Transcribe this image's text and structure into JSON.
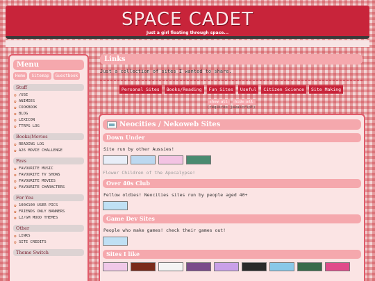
{
  "header": {
    "title": "SPACE CADET",
    "tagline": "Just a girl floating through space..."
  },
  "sidebar": {
    "menu_title": "Menu",
    "menu_buttons": [
      "Home",
      "Sitemap",
      "Guestbook"
    ],
    "sections": [
      {
        "title": "Stuff",
        "items": [
          "/USE",
          "ANIMIES",
          "COOKBOOK",
          "BLOG",
          "LEXICON",
          "TTRPG LOG"
        ]
      },
      {
        "title": "Books/Movies",
        "items": [
          "READING LOG",
          "A26 MOVIE CHALLENGE"
        ]
      },
      {
        "title": "Favs",
        "items": [
          "FAVOURITE MUSIC",
          "FAVOURITE TV SHOWS",
          "FAVOURITE MOVIES",
          "FAVOURITE CHARACTERS"
        ]
      },
      {
        "title": "For You",
        "items": [
          "100X100 USER PICS",
          "FRIENDS ONLY BANNERS",
          "L2/GM MOOD THEMES"
        ]
      },
      {
        "title": "Other",
        "items": [
          "LINKS",
          "SITE CREDITS"
        ]
      },
      {
        "title": "Theme Switch",
        "items": []
      }
    ]
  },
  "links": {
    "title": "Links",
    "intro": "Just a collection of sites I wanted to share.",
    "categories": [
      "Personal Sites",
      "Books/Reading",
      "Fun Sites",
      "Useful",
      "Citizen Science",
      "Site Making"
    ],
    "view_buttons": [
      "show all",
      "hide all"
    ],
    "js_note": "(requires javascript)"
  },
  "neocities": {
    "title": "Neocities / Nekoweb Sites",
    "sections": [
      {
        "title": "Down Under",
        "desc": "Site run by other Aussies!"
      },
      {
        "quote": "Flower Children of the Apocalypse!"
      },
      {
        "title": "Over 40s Club",
        "desc": "Fellow oldies! Neocities sites run by people aged 40+"
      },
      {
        "title": "Game Dev Sites",
        "desc": "People who make games! check their games out!"
      },
      {
        "title": "Sites I like"
      }
    ]
  },
  "colors": {
    "header_red": "#c8243a",
    "pill_pink": "#f5a8ad",
    "panel_bg": "#fbe4e4"
  }
}
